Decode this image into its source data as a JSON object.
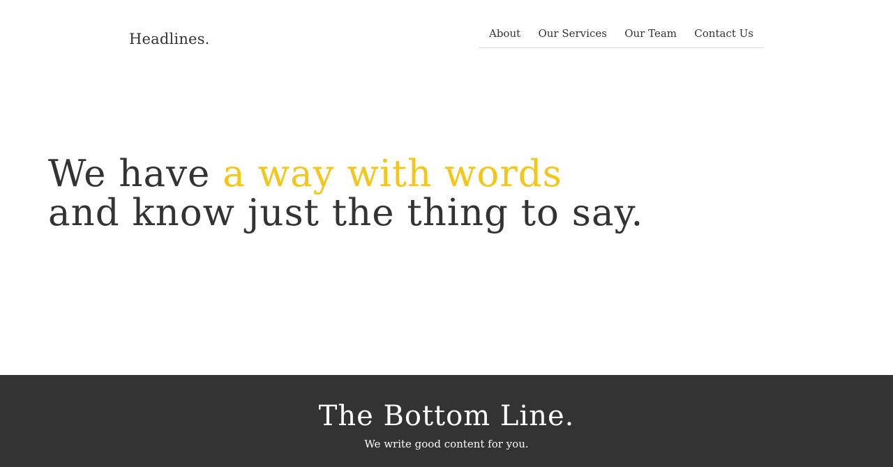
{
  "header": {
    "logo": "Headlines.",
    "nav": [
      {
        "label": "About"
      },
      {
        "label": "Our Services"
      },
      {
        "label": "Our Team"
      },
      {
        "label": "Contact Us"
      }
    ]
  },
  "hero": {
    "line1_prefix": "We have ",
    "line1_accent": "a way with words",
    "line2": "and know just the thing to say."
  },
  "bottom": {
    "title": "The Bottom Line.",
    "subtitle": "We write good content for you."
  },
  "colors": {
    "accent": "#f5c518",
    "text": "#333333",
    "footer_bg": "#333333",
    "nav_border": "#d9d9d9"
  }
}
